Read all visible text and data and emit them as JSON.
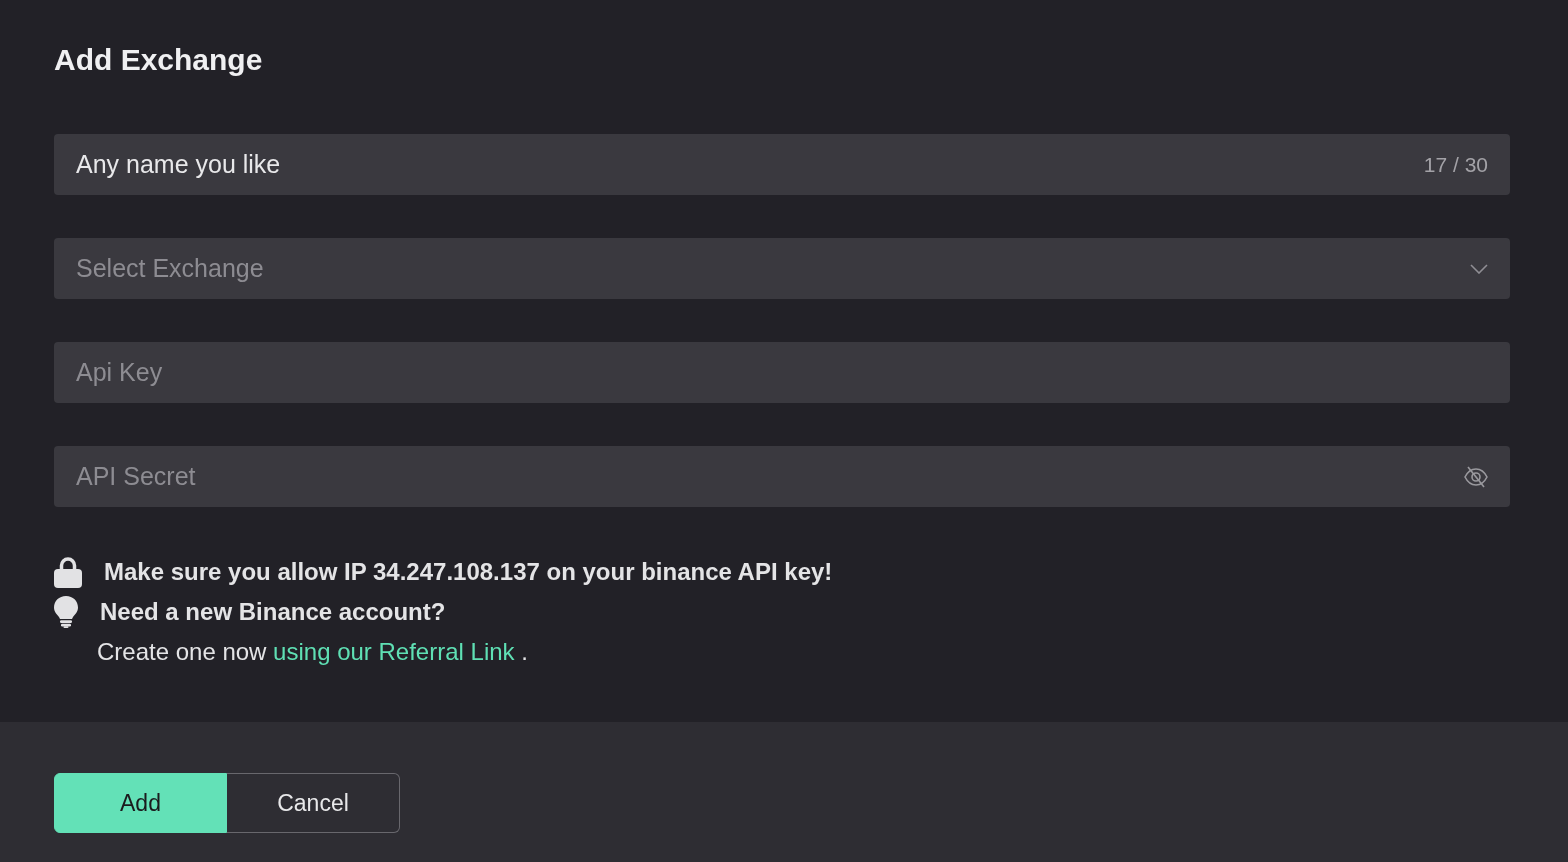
{
  "dialog": {
    "title": "Add Exchange"
  },
  "fields": [
    {
      "kind": "text",
      "value": "Any name you like",
      "counter": "17 / 30"
    },
    {
      "kind": "select",
      "placeholder": "Select Exchange"
    },
    {
      "kind": "text",
      "placeholder": "Api Key"
    },
    {
      "kind": "password",
      "placeholder": "API Secret",
      "revealed": false
    }
  ],
  "notes": [
    {
      "kind": "lock",
      "text": "Make sure you allow IP 34.247.108.137 on your binance API key!"
    },
    {
      "kind": "bulb",
      "text": "Need a new Binance account?"
    }
  ],
  "referral": {
    "text": "Create one now",
    "link": "using our Referral Link",
    "end": "."
  },
  "buttons": [
    {
      "label": "Add",
      "kind": "primary"
    },
    {
      "label": "Cancel",
      "kind": "secondary"
    }
  ]
}
